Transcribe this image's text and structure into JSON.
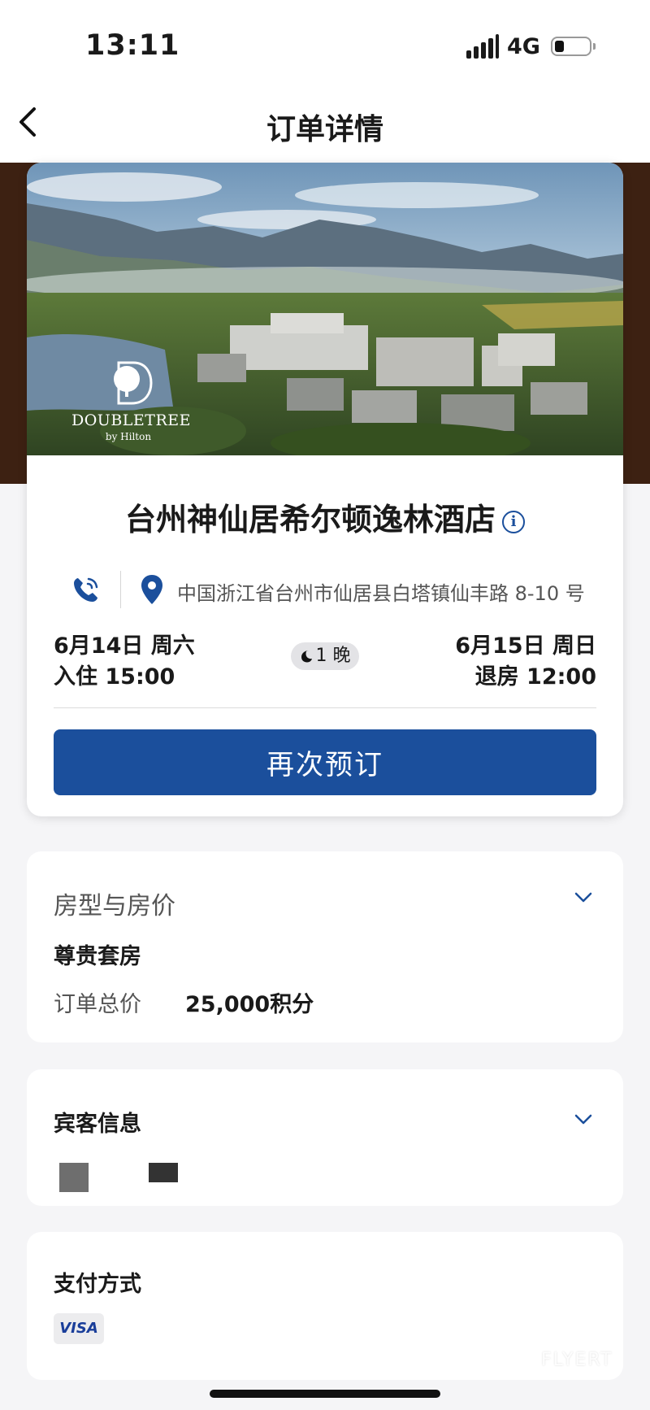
{
  "status_bar": {
    "time": "13:11",
    "network": "4G",
    "battery_level": 0.2
  },
  "nav": {
    "title": "订单详情",
    "back_icon": "chevron-left-icon"
  },
  "hotel": {
    "logo_text": "DOUBLETREE",
    "logo_sub": "by Hilton",
    "name": "台州神仙居希尔顿逸林酒店",
    "address": "中国浙江省台州市仙居县白塔镇仙丰路 8-10 号",
    "check_in_date": "6月14日 周六",
    "check_in_time": "入住 15:00",
    "nights": "1 晚",
    "check_out_date": "6月15日 周日",
    "check_out_time": "退房 12:00",
    "rebook_label": "再次预订"
  },
  "room_section": {
    "title": "房型与房价",
    "room_type": "尊贵套房",
    "total_label": "订单总价",
    "total_value": "25,000积分"
  },
  "guest_section": {
    "title": "宾客信息"
  },
  "payment_section": {
    "title": "支付方式",
    "card_brand": "VISA"
  },
  "watermark": "FLYERT",
  "colors": {
    "accent": "#1b4f9c",
    "brown_band": "#3d2112",
    "background": "#f5f5f7"
  }
}
